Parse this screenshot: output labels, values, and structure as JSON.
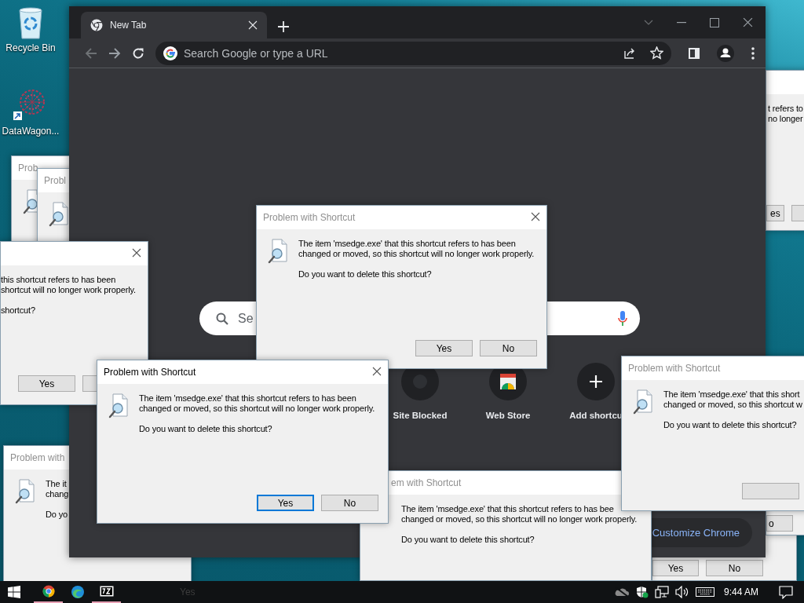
{
  "desktop_icons": [
    {
      "label": "Recycle Bin",
      "kind": "recycle"
    },
    {
      "label": "DataWagon...",
      "kind": "app"
    }
  ],
  "windows": [
    {
      "kind": "dialog",
      "title": "Prob",
      "active": false,
      "icon": true
    },
    {
      "kind": "dialog",
      "title": "Probl",
      "active": false,
      "icon": true
    },
    {
      "kind": "dialog",
      "lines": [
        "t refers to",
        "no longer"
      ],
      "buttons": [
        {
          "label": "es",
          "focused": false
        },
        {
          "focused": false
        }
      ]
    },
    {
      "kind": "dialog",
      "buttons": [
        {
          "label": "Yes",
          "focused": false
        },
        {
          "label": "No",
          "focused": false
        }
      ]
    },
    {
      "kind": "dialog",
      "buttons": [
        {
          "label": "o",
          "focused": false
        }
      ]
    },
    {
      "kind": "dialog",
      "title": "Problem with",
      "active": false,
      "icon": true,
      "lines": [
        "The it",
        "chang"
      ],
      "question": "Do yo"
    },
    {
      "kind": "browser",
      "tab": {
        "title": "New Tab",
        "selected": true
      },
      "address_bar": {
        "placeholder": "Search Google or type a URL"
      },
      "search_box": {
        "placeholder": "Se"
      },
      "shortcuts": [
        {
          "label": "Site Blocked",
          "kind": "blocked"
        },
        {
          "label": "Web Store",
          "kind": "store"
        },
        {
          "label": "Add shortcu",
          "kind": "add"
        }
      ],
      "customize_button": "Customize Chrome"
    },
    {
      "kind": "dialog",
      "close": true,
      "lines": [
        "this shortcut refers to has been",
        "shortcut will no longer work properly."
      ],
      "question": "shortcut?",
      "buttons": [
        {
          "label": "Yes",
          "focused": false
        },
        {
          "focused": false
        }
      ]
    },
    {
      "kind": "dialog",
      "title": "Problem with Shortcut",
      "active": false,
      "close": true,
      "icon": true,
      "lines": [
        "The item 'msedge.exe' that this shortcut refers to has been",
        "changed or moved, so this shortcut will no longer work properly."
      ],
      "question": "Do you want to delete this shortcut?",
      "buttons": [
        {
          "label": "Yes",
          "focused": false
        },
        {
          "label": "No",
          "focused": false
        }
      ]
    },
    {
      "kind": "dialog",
      "title": "em with Shortcut",
      "active": false,
      "lines": [
        "The item 'msedge.exe' that this shortcut refers to has bee",
        "changed or moved, so this shortcut will no longer work properly."
      ],
      "question": "Do you want to delete this shortcut?"
    },
    {
      "kind": "dialog",
      "title": "Problem with Shortcut",
      "active": true,
      "close": true,
      "icon": true,
      "lines": [
        "The item 'msedge.exe' that this shortcut refers to has been",
        "changed or moved, so this shortcut will no longer work properly."
      ],
      "question": "Do you want to delete this shortcut?",
      "buttons": [
        {
          "label": "Yes",
          "focused": true
        },
        {
          "label": "No",
          "focused": false
        }
      ]
    },
    {
      "kind": "dialog",
      "title": "Problem with Shortcut",
      "active": false,
      "icon": true,
      "lines": [
        "The item 'msedge.exe' that this short",
        "changed or moved, so this shortcut w"
      ],
      "question": "Do you want to delete this shortcut?",
      "buttons": [
        {
          "focused": false
        }
      ]
    }
  ],
  "taskbar": {
    "faded_text": "Yes",
    "clock": "9:44 AM"
  }
}
